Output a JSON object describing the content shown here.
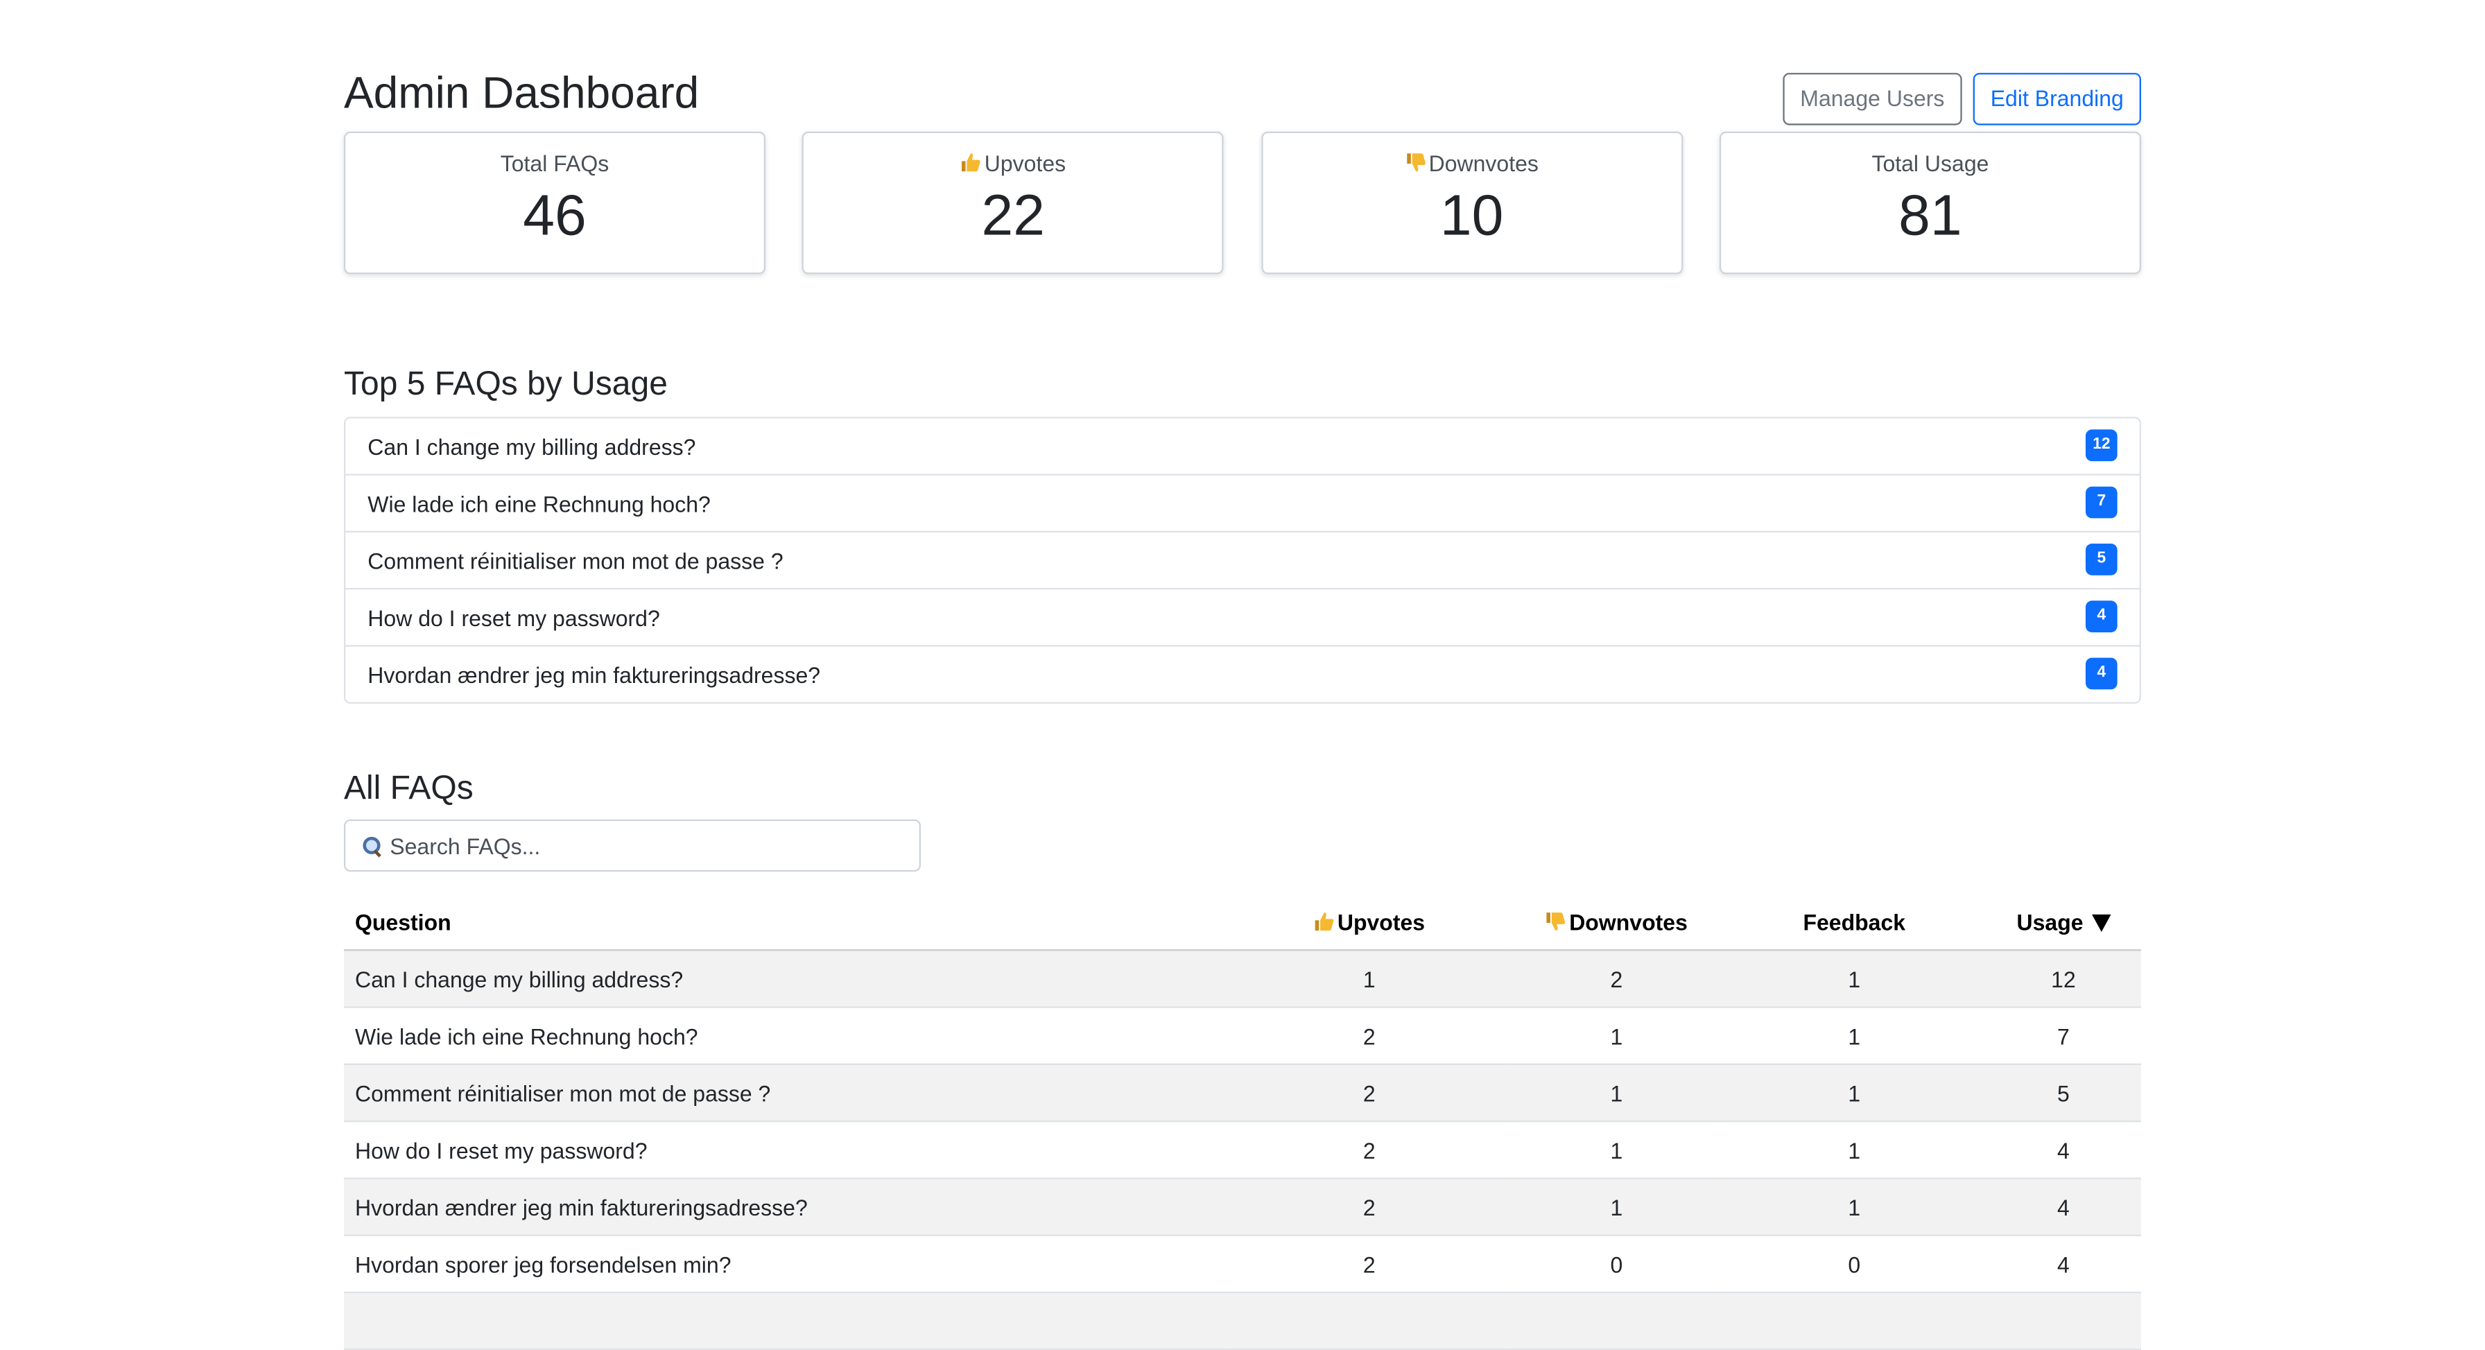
{
  "header": {
    "title": "Admin Dashboard",
    "manage_users_label": "Manage Users",
    "edit_branding_label": "Edit Branding"
  },
  "stats": [
    {
      "label": "Total FAQs",
      "value": "46",
      "icon": ""
    },
    {
      "label": "Upvotes",
      "value": "22",
      "icon": "thumbs-up-icon"
    },
    {
      "label": "Downvotes",
      "value": "10",
      "icon": "thumbs-down-icon"
    },
    {
      "label": "Total Usage",
      "value": "81",
      "icon": ""
    }
  ],
  "top_faqs": {
    "title": "Top 5 FAQs by Usage",
    "items": [
      {
        "question": "Can I change my billing address?",
        "usage": "12"
      },
      {
        "question": "Wie lade ich eine Rechnung hoch?",
        "usage": "7"
      },
      {
        "question": "Comment réinitialiser mon mot de passe ?",
        "usage": "5"
      },
      {
        "question": "How do I reset my password?",
        "usage": "4"
      },
      {
        "question": "Hvordan ændrer jeg min faktureringsadresse?",
        "usage": "4"
      }
    ]
  },
  "all_faqs": {
    "title": "All FAQs",
    "search_placeholder": "Search FAQs...",
    "columns": {
      "question": "Question",
      "upvotes": "Upvotes",
      "downvotes": "Downvotes",
      "feedback": "Feedback",
      "usage": "Usage"
    },
    "rows": [
      {
        "question": "Can I change my billing address?",
        "upvotes": "1",
        "downvotes": "2",
        "feedback": "1",
        "usage": "12"
      },
      {
        "question": "Wie lade ich eine Rechnung hoch?",
        "upvotes": "2",
        "downvotes": "1",
        "feedback": "1",
        "usage": "7"
      },
      {
        "question": "Comment réinitialiser mon mot de passe ?",
        "upvotes": "2",
        "downvotes": "1",
        "feedback": "1",
        "usage": "5"
      },
      {
        "question": "How do I reset my password?",
        "upvotes": "2",
        "downvotes": "1",
        "feedback": "1",
        "usage": "4"
      },
      {
        "question": "Hvordan ændrer jeg min faktureringsadresse?",
        "upvotes": "2",
        "downvotes": "1",
        "feedback": "1",
        "usage": "4"
      },
      {
        "question": "Hvordan sporer jeg forsendelsen min?",
        "upvotes": "2",
        "downvotes": "0",
        "feedback": "0",
        "usage": "4"
      }
    ]
  },
  "colors": {
    "accent": "#0d6efd",
    "secondary": "#6c757d",
    "stripe": "#f2f2f2"
  }
}
